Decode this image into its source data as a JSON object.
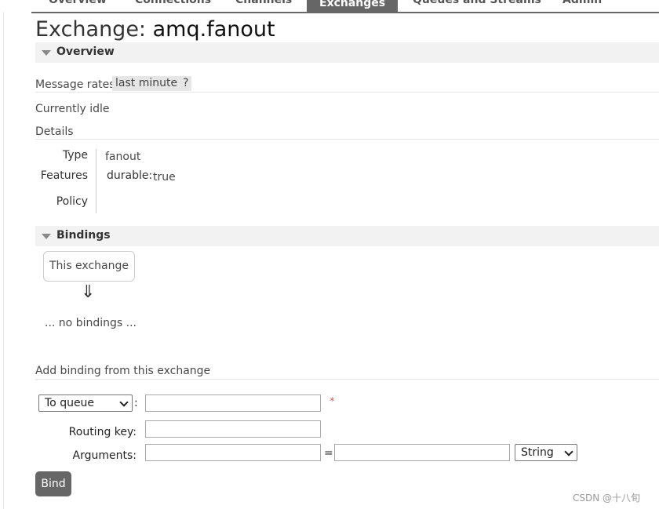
{
  "nav": {
    "items": [
      "Overview",
      "Connections",
      "Channels",
      "Exchanges",
      "Queues and Streams",
      "Admin"
    ],
    "active": "Exchanges"
  },
  "title": {
    "prefix": "Exchange:",
    "name": "amq.fanout"
  },
  "overview": {
    "heading": "Overview",
    "message_rates_label": "Message rates",
    "rate_period": "last minute",
    "help": "?",
    "status": "Currently idle",
    "details_label": "Details",
    "details": {
      "type_label": "Type",
      "type_value": "fanout",
      "features_label": "Features",
      "feature_key": "durable:",
      "feature_value": "true",
      "policy_label": "Policy"
    }
  },
  "bindings": {
    "heading": "Bindings",
    "this_exchange": "This exchange",
    "arrow": "⇓",
    "empty": "... no bindings ..."
  },
  "add_binding": {
    "heading": "Add binding from this exchange",
    "destination_select": "To queue",
    "colon": ":",
    "required_mark": "*",
    "routing_key_label": "Routing key:",
    "arguments_label": "Arguments:",
    "equals": "=",
    "type_select": "String",
    "bind_label": "Bind"
  },
  "watermark": "CSDN @十八旬"
}
